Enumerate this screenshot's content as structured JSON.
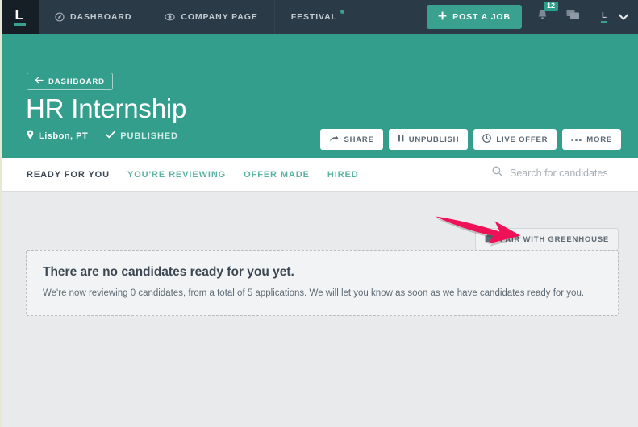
{
  "topnav": {
    "logo_letter": "L",
    "items": [
      {
        "label": "DASHBOARD",
        "icon": "compass-icon"
      },
      {
        "label": "COMPANY PAGE",
        "icon": "eye-icon"
      },
      {
        "label": "FESTIVAL",
        "icon": "none",
        "has_dot": true
      }
    ],
    "post_job_label": "POST A JOB",
    "notifications_count": "12",
    "avatar_letter": "L"
  },
  "hero": {
    "back_label": "DASHBOARD",
    "title": "HR Internship",
    "location": "Lisbon, PT",
    "status": "PUBLISHED",
    "actions": [
      {
        "label": "SHARE",
        "icon": "share-arrow-icon"
      },
      {
        "label": "UNPUBLISH",
        "icon": "pause-icon"
      },
      {
        "label": "LIVE OFFER",
        "icon": "clock-icon"
      },
      {
        "label": "MORE",
        "icon": "ellipsis-icon"
      }
    ]
  },
  "tabs": [
    {
      "label": "READY FOR YOU",
      "active": true
    },
    {
      "label": "YOU'RE REVIEWING",
      "active": false
    },
    {
      "label": "OFFER MADE",
      "active": false
    },
    {
      "label": "HIRED",
      "active": false
    }
  ],
  "search": {
    "placeholder": "Search for candidates",
    "value": ""
  },
  "content": {
    "greenhouse_label": "PAIR WITH GREENHOUSE",
    "empty_title": "There are no candidates ready for you yet.",
    "empty_subtitle": "We're now reviewing 0 candidates, from a total of 5 applications. We will let you know as soon as we have candidates ready for you."
  },
  "colors": {
    "nav_bg": "#2b3a47",
    "logo_tile_bg": "#161f25",
    "teal": "#349e8d",
    "accent_teal": "#3aa08f",
    "page_bg": "#e9eaec",
    "arrow": "#ef1158"
  }
}
